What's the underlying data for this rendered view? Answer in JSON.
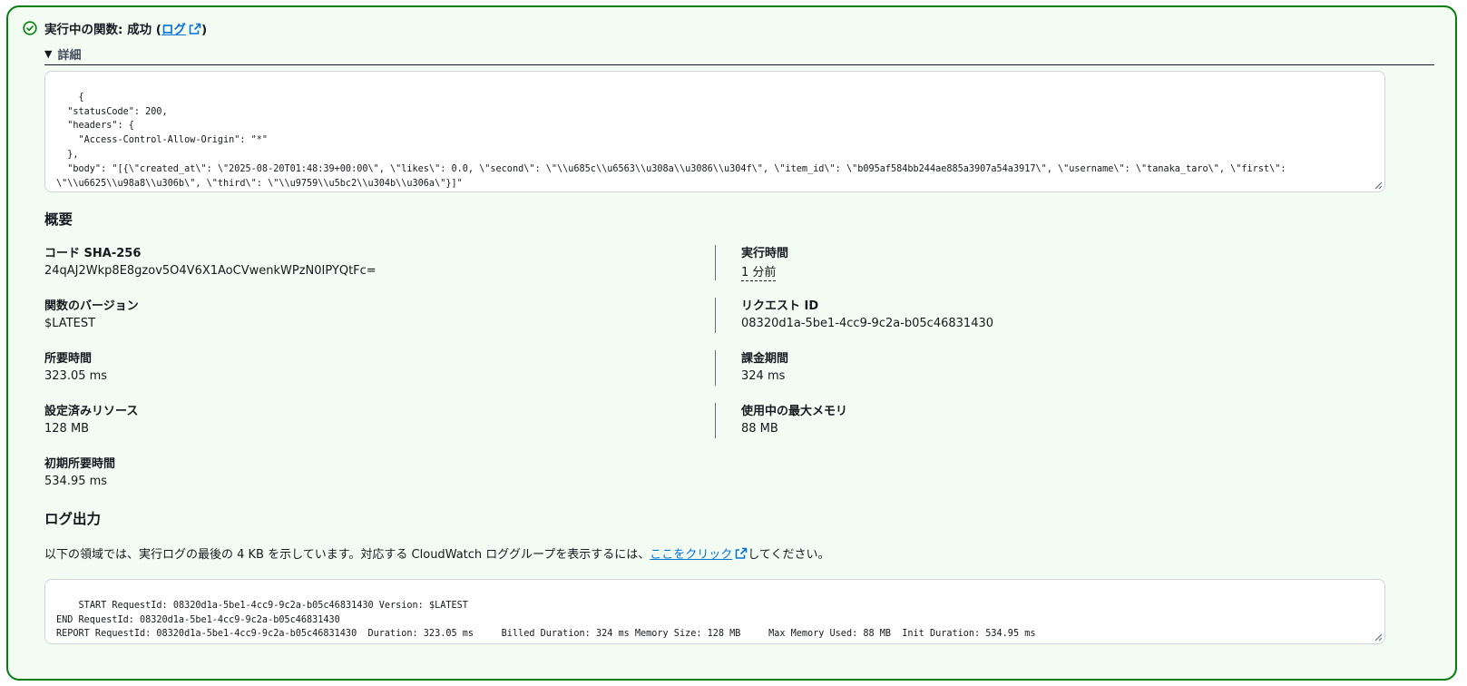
{
  "status": {
    "prefix": "実行中の関数: 成功 (",
    "log_link": "ログ",
    "suffix": ")",
    "colors": {
      "success": "#037f0c",
      "background": "#f2fcf3",
      "link": "#0972d3"
    },
    "icon": "success-check-icon"
  },
  "details": {
    "toggle_label": "詳細",
    "response_text": "{\n  \"statusCode\": 200,\n  \"headers\": {\n    \"Access-Control-Allow-Origin\": \"*\"\n  },\n  \"body\": \"[{\\\"created_at\\\": \\\"2025-08-20T01:48:39+00:00\\\", \\\"likes\\\": 0.0, \\\"second\\\": \\\"\\\\u685c\\\\u6563\\\\u308a\\\\u3086\\\\u304f\\\", \\\"item_id\\\": \\\"b095af584bb244ae885a3907a54a3917\\\", \\\"username\\\": \\\"tanaka_taro\\\", \\\"first\\\":\n\\\"\\\\u6625\\\\u98a8\\\\u306b\\\", \\\"third\\\": \\\"\\\\u9759\\\\u5bc2\\\\u304b\\\\u306a\\\"}]\"\n}"
  },
  "summary": {
    "title": "概要",
    "left": [
      {
        "label": "コード SHA-256",
        "value": "24qAJ2Wkp8E8gzov5O4V6X1AoCVwenkWPzN0IPYQtFc="
      },
      {
        "label": "関数のバージョン",
        "value": "$LATEST"
      },
      {
        "label": "所要時間",
        "value": "323.05 ms"
      },
      {
        "label": "設定済みリソース",
        "value": "128 MB"
      },
      {
        "label": "初期所要時間",
        "value": "534.95 ms"
      }
    ],
    "right": [
      {
        "label": "実行時間",
        "value": "1 分前"
      },
      {
        "label": "リクエスト ID",
        "value": "08320d1a-5be1-4cc9-9c2a-b05c46831430"
      },
      {
        "label": "課金期間",
        "value": "324 ms"
      },
      {
        "label": "使用中の最大メモリ",
        "value": "88 MB"
      }
    ]
  },
  "log_output": {
    "title": "ログ出力",
    "description_prefix": "以下の領域では、実行ログの最後の 4 KB を示しています。対応する CloudWatch ロググループを表示するには、",
    "link_text": "ここをクリック",
    "description_suffix": "してください。",
    "log_text": "START RequestId: 08320d1a-5be1-4cc9-9c2a-b05c46831430 Version: $LATEST\nEND RequestId: 08320d1a-5be1-4cc9-9c2a-b05c46831430\nREPORT RequestId: 08320d1a-5be1-4cc9-9c2a-b05c46831430  Duration: 323.05 ms     Billed Duration: 324 ms Memory Size: 128 MB     Max Memory Used: 88 MB  Init Duration: 534.95 ms"
  }
}
